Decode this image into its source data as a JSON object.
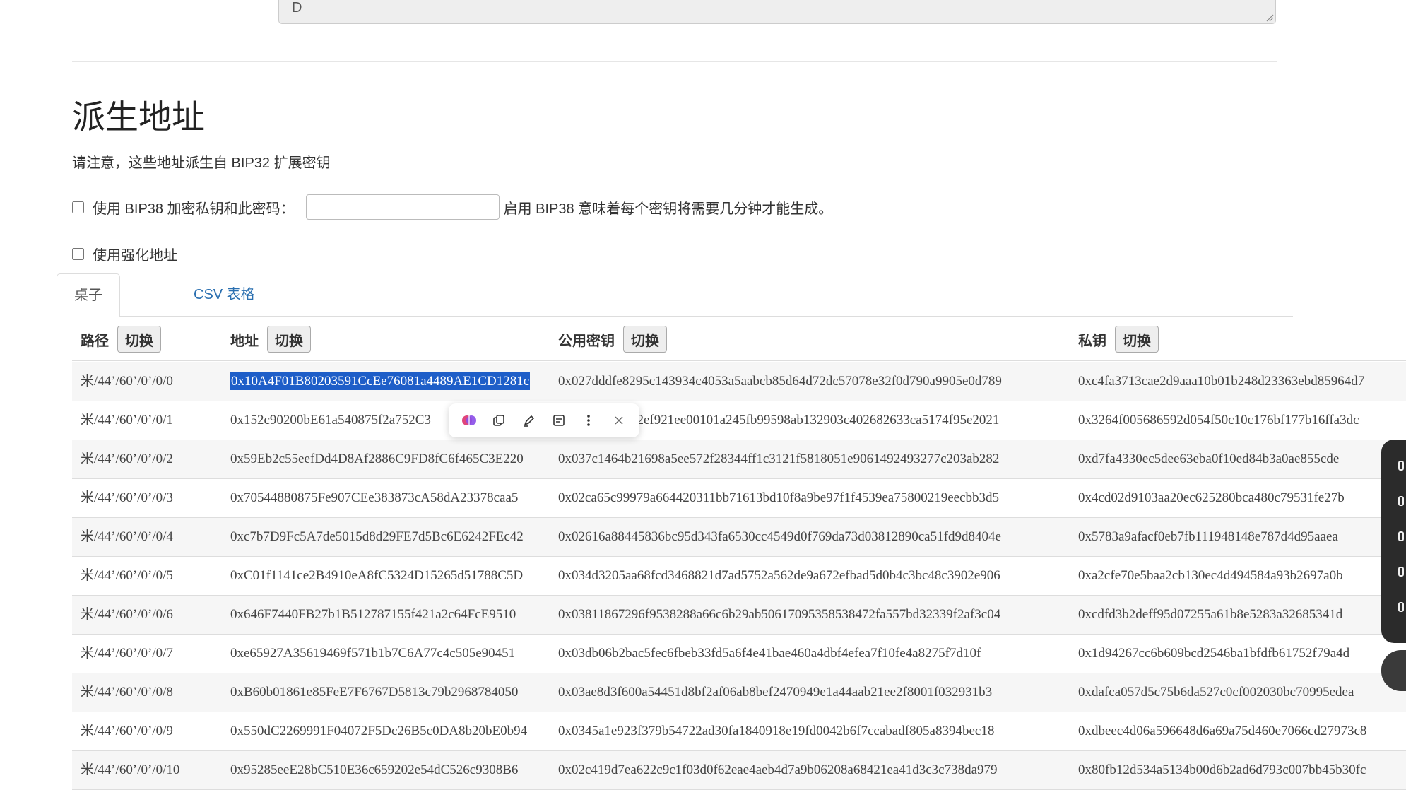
{
  "top_textarea": {
    "value": "D"
  },
  "section": {
    "title": "派生地址",
    "note": "请注意，这些地址派生自 BIP32 扩展密钥"
  },
  "options": {
    "bip38_label": "使用 BIP38 加密私钥和此密码：",
    "bip38_password": "",
    "bip38_hint": "启用 BIP38 意味着每个密钥将需要几分钟才能生成。",
    "hardened_label": "使用强化地址"
  },
  "tabs": [
    {
      "label": "桌子"
    },
    {
      "label": "CSV 表格"
    }
  ],
  "table": {
    "headers": {
      "path": "路径",
      "address": "地址",
      "public_key": "公用密钥",
      "private_key": "私钥",
      "toggle": "切换"
    },
    "rows": [
      {
        "path": "米/44’/60’/0’/0/0",
        "address": "0x10A4F01B80203591CcEe76081a4489AE1CD1281c",
        "pub": "0x027dddfe8295c143934c4053a5aabcb85d64d72dc57078e32f0d790a9905e0d789",
        "priv": "0xc4fa3713cae2d9aaa10b01b248d23363ebd85964d7"
      },
      {
        "path": "米/44’/60’/0’/0/1",
        "address": "0x152c90200bE61a540875f2a752C3",
        "pub": "52ef921ee00101a245fb99598ab132903c402682633ca5174f95e2021",
        "priv": "0x3264f005686592d054f50c10c176bf177b16ffa3dc"
      },
      {
        "path": "米/44’/60’/0’/0/2",
        "address": "0x59Eb2c55eefDd4D8Af2886C9FD8fC6f465C3E220",
        "pub": "0x037c1464b21698a5ee572f28344ff1c3121f5818051e9061492493277c203ab282",
        "priv": "0xd7fa4330ec5dee63eba0f10ed84b3a0ae855cde"
      },
      {
        "path": "米/44’/60’/0’/0/3",
        "address": "0x70544880875Fe907CEe383873cA58dA23378caa5",
        "pub": "0x02ca65c99979a664420311bb71613bd10f8a9be97f1f4539ea75800219eecbb3d5",
        "priv": "0x4cd02d9103aa20ec625280bca480c79531fe27b"
      },
      {
        "path": "米/44’/60’/0’/0/4",
        "address": "0xc7b7D9Fc5A7de5015d8d29FE7d5Bc6E6242FEc42",
        "pub": "0x02616a88445836bc95d343fa6530cc4549d0f769da73d03812890ca51fd9d8404e",
        "priv": "0x5783a9afacf0eb7fb111948148e787d4d95aaea"
      },
      {
        "path": "米/44’/60’/0’/0/5",
        "address": "0xC01f1141ce2B4910eA8fC5324D15265d51788C5D",
        "pub": "0x034d3205aa68fcd3468821d7ad5752a562de9a672efbad5d0b4c3bc48c3902e906",
        "priv": "0xa2cfe70e5baa2cb130ec4d494584a93b2697a0b"
      },
      {
        "path": "米/44’/60’/0’/0/6",
        "address": "0x646F7440FB27b1B512787155f421a2c64FcE9510",
        "pub": "0x03811867296f9538288a66c6b29ab50617095358538472fa557bd32339f2af3c04",
        "priv": "0xcdfd3b2deff95d07255a61b8e5283a32685341d"
      },
      {
        "path": "米/44’/60’/0’/0/7",
        "address": "0xe65927A35619469f571b1b7C6A77c4c505e90451",
        "pub": "0x03db06b2bac5fec6fbeb33fd5a6f4e41bae460a4dbf4efea7f10fe4a8275f7d10f",
        "priv": "0x1d94267cc6b609bcd2546ba1bfdfb61752f79a4d"
      },
      {
        "path": "米/44’/60’/0’/0/8",
        "address": "0xB60b01861e85FeE7F6767D5813c79b2968784050",
        "pub": "0x03ae8d3f600a54451d8bf2af06ab8bef2470949e1a44aab21ee2f8001f032931b3",
        "priv": "0xdafca057d5c75b6da527c0cf002030bc70995edea"
      },
      {
        "path": "米/44’/60’/0’/0/9",
        "address": "0x550dC2269991F04072F5Dc26B5c0DA8b20bE0b94",
        "pub": "0x0345a1e923f379b54722ad30fa1840918e19fd0042b6f7ccabadf805a8394bec18",
        "priv": "0xdbeec4d06a596648d6a69a75d460e7066cd27973c8"
      },
      {
        "path": "米/44’/60’/0’/0/10",
        "address": "0x95285eeE28bC510E36c659202e54dC526c9308B6",
        "pub": "0x02c419d7ea622c9c1f03d0f62eae4aeb4d7a9b06208a68421ea41d3c3c738da979",
        "priv": "0x80fb12d534a5134b00d6b2ad6d793c007bb45b30fc"
      }
    ]
  },
  "toolbar": {
    "icons": [
      "brain-icon",
      "copy-icon",
      "highlight-pen-icon",
      "note-icon",
      "more-icon",
      "close-icon"
    ]
  },
  "colors": {
    "selection": "#1e5ec8",
    "link": "#2a6fb0",
    "stripe": "#f6f6f6"
  }
}
